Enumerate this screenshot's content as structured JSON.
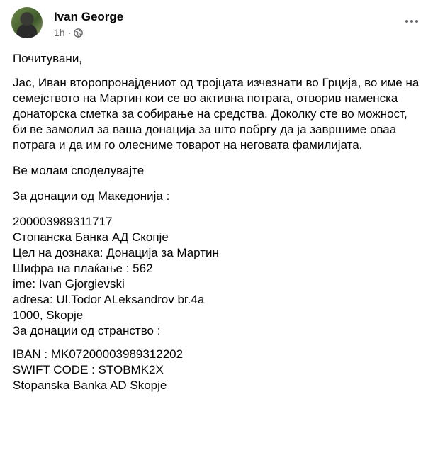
{
  "post": {
    "author": "Ivan George",
    "time": "1h",
    "dot": "·",
    "privacy_icon": "globe-icon",
    "more_icon": "more-options-icon"
  },
  "content": {
    "greeting": "Почитувани,",
    "paragraph": "Јас, Иван второпронајдениот од тројцата изчезнати во Грција, во име на семејството на Мартин кои се во активна потрага, отворив наменска донаторска сметка за собирање на средства. Доколку сте во можност, би ве замолил за ваша донација за што побргу да ја завршиме оваа потрага и да им го олесниме товарот на неговата фамилијата.",
    "share": "Ве молам споделувајте",
    "mk_heading": "За донации од Македонија :",
    "mk_lines": [
      "200003989311717",
      "Стопанска Банка АД Скопје",
      "Цел на дознака: Донација за Мартин",
      "Шифра на плаќање : 562",
      "ime: Ivan Gjorgievski",
      "adresa: Ul.Todor ALeksandrov  br.4a",
      "1000, Skopje",
      "За донации од странство :"
    ],
    "intl_lines": [
      "IBAN : MK07200003989312202",
      "SWIFT CODE : STOBMK2X",
      "Stopanska Banka AD Skopje"
    ]
  }
}
